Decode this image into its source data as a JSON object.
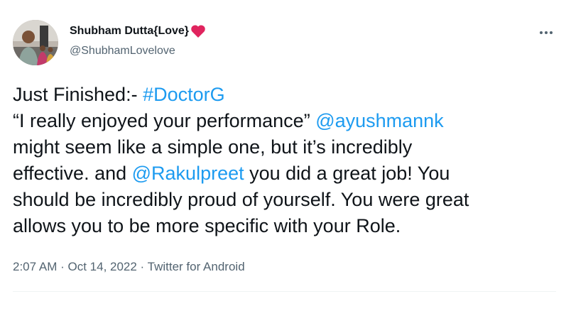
{
  "author": {
    "display_name": "Shubham Dutta{Love}",
    "handle": "@ShubhamLovelove",
    "avatar_icon": "profile-photo",
    "name_emoji": "red-heart-icon"
  },
  "tweet": {
    "line1_prefix": "Just Finished:- ",
    "hashtag": "#DoctorG",
    "line2_prefix": "“I really enjoyed your performance” ",
    "mention1": "@ayushmannk",
    "line3": "might seem like a simple one, but it’s incredibly",
    "line4_prefix": "effective. and ",
    "mention2": "@Rakulpreet",
    "line4_suffix": " you did a great job! You",
    "line5": "should be incredibly proud of yourself. You were great",
    "line6": "allows you to be more specific with your Role."
  },
  "meta": {
    "time": "2:07 AM",
    "separator1": " · ",
    "date": "Oct 14, 2022",
    "separator2": " · ",
    "source": "Twitter for Android"
  },
  "colors": {
    "link": "#1d9bf0",
    "secondary_text": "#536471",
    "primary_text": "#0f1419",
    "heart": "#e0245e"
  },
  "icons": {
    "more": "more-dots-icon"
  }
}
